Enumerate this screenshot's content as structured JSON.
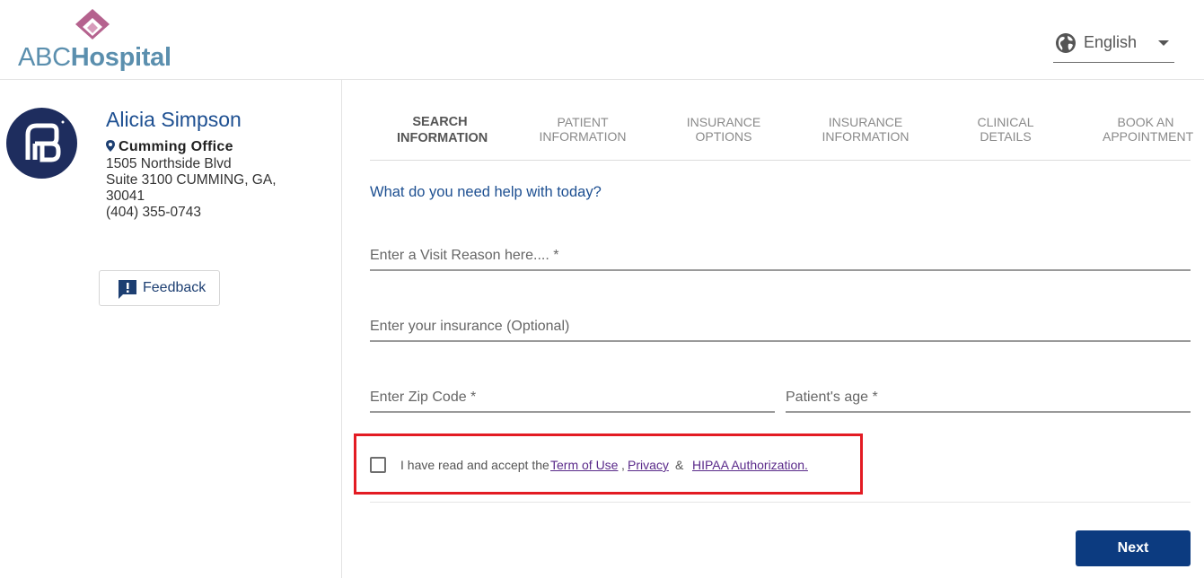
{
  "brand": {
    "logo_prefix": "ABC",
    "logo_suffix": "Hospital",
    "mark_color": "#b5628e",
    "text_color": "#5b8fae"
  },
  "language": {
    "label": "English",
    "icon": "globe-icon"
  },
  "provider": {
    "name": "Alicia Simpson",
    "office": "Cumming Office",
    "address_lines": [
      "1505 Northside Blvd",
      "Suite 3100 CUMMING, GA,",
      "30041",
      "(404) 355-0743"
    ],
    "avatar_color": "#1e2d5e"
  },
  "feedback": {
    "label": "Feedback",
    "icon": "feedback-icon"
  },
  "steps": [
    {
      "line1": "SEARCH",
      "line2": "INFORMATION",
      "active": true
    },
    {
      "line1": "PATIENT",
      "line2": "INFORMATION",
      "active": false
    },
    {
      "line1": "INSURANCE",
      "line2": "OPTIONS",
      "active": false
    },
    {
      "line1": "INSURANCE",
      "line2": "INFORMATION",
      "active": false
    },
    {
      "line1": "CLINICAL",
      "line2": "DETAILS",
      "active": false
    },
    {
      "line1": "BOOK AN",
      "line2": "APPOINTMENT",
      "active": false
    }
  ],
  "form": {
    "prompt": "What do you need help with today?",
    "visit_reason_placeholder": "Enter a Visit Reason here.... *",
    "insurance_placeholder": "Enter your insurance (Optional)",
    "zip_placeholder": "Enter Zip Code *",
    "age_placeholder": "Patient's age *"
  },
  "consent": {
    "text": "I have read and accept the",
    "terms_link": "Term of Use",
    "comma": ",",
    "privacy_link": "Privacy",
    "ampersand": "&",
    "hipaa_link": "HIPAA Authorization.",
    "checked": false,
    "highlight_color": "#e31b23"
  },
  "actions": {
    "next_label": "Next",
    "primary_color": "#0c3b80"
  }
}
